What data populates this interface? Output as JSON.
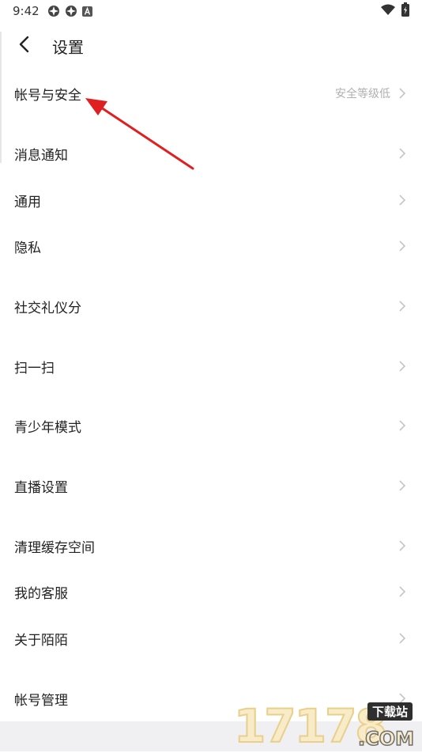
{
  "status_bar": {
    "time": "9:42",
    "icons": [
      "vpn-flower-icon",
      "vpn-flower-icon",
      "app-a-icon",
      "wifi-icon",
      "battery-charging-icon"
    ]
  },
  "header": {
    "title": "设置",
    "back_icon": "chevron-left-icon"
  },
  "settings": {
    "items": [
      {
        "label": "帐号与安全",
        "value": "安全等级低"
      },
      {
        "label": "消息通知"
      },
      {
        "label": "通用"
      },
      {
        "label": "隐私"
      },
      {
        "label": "社交礼仪分"
      },
      {
        "label": "扫一扫"
      },
      {
        "label": "青少年模式"
      },
      {
        "label": "直播设置"
      },
      {
        "label": "清理缓存空间"
      },
      {
        "label": "我的客服"
      },
      {
        "label": "关于陌陌"
      },
      {
        "label": "帐号管理"
      }
    ]
  },
  "annotation": {
    "arrow_color": "#e02020",
    "target": "帐号与安全"
  },
  "watermark": {
    "digits": "17178",
    "badge": "下载站",
    "domain": ".COM"
  }
}
